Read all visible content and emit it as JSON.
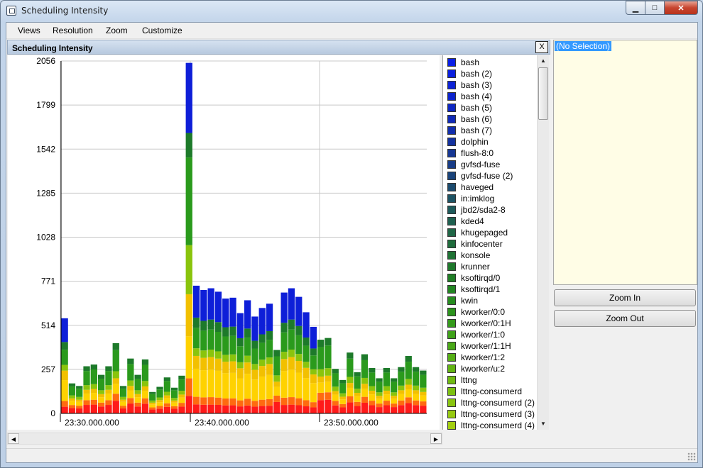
{
  "window": {
    "title": "Scheduling Intensity",
    "minimize_glyph": "▁",
    "maximize_glyph": "□",
    "close_glyph": "✕"
  },
  "menu": [
    "Views",
    "Resolution",
    "Zoom",
    "Customize"
  ],
  "pane": {
    "title": "Scheduling Intensity",
    "close_label": "X"
  },
  "details": {
    "selection_text": "(No Selection)"
  },
  "buttons": {
    "zoom_in": "Zoom In",
    "zoom_out": "Zoom Out"
  },
  "legend": [
    {
      "label": "bash",
      "color": "#0a1fe6"
    },
    {
      "label": "bash (2)",
      "color": "#0b20df"
    },
    {
      "label": "bash (3)",
      "color": "#0c22d6"
    },
    {
      "label": "bash (4)",
      "color": "#0d24cc"
    },
    {
      "label": "bash (5)",
      "color": "#0e27c2"
    },
    {
      "label": "bash (6)",
      "color": "#102ab8"
    },
    {
      "label": "bash (7)",
      "color": "#122eac"
    },
    {
      "label": "dolphin",
      "color": "#14329f"
    },
    {
      "label": "flush-8:0",
      "color": "#163793"
    },
    {
      "label": "gvfsd-fuse",
      "color": "#183c86"
    },
    {
      "label": "gvfsd-fuse (2)",
      "color": "#1a437a"
    },
    {
      "label": "haveged",
      "color": "#1c4b6e"
    },
    {
      "label": "in:imklog",
      "color": "#1d5363"
    },
    {
      "label": "jbd2/sda2-8",
      "color": "#1e5a5a"
    },
    {
      "label": "kded4",
      "color": "#1f6050"
    },
    {
      "label": "khugepaged",
      "color": "#1f6646"
    },
    {
      "label": "kinfocenter",
      "color": "#1f6c3c"
    },
    {
      "label": "konsole",
      "color": "#1f7234"
    },
    {
      "label": "krunner",
      "color": "#1f782c"
    },
    {
      "label": "ksoftirqd/0",
      "color": "#207e26"
    },
    {
      "label": "ksoftirqd/1",
      "color": "#228522"
    },
    {
      "label": "kwin",
      "color": "#268c1f"
    },
    {
      "label": "kworker/0:0",
      "color": "#2c931d"
    },
    {
      "label": "kworker/0:1H",
      "color": "#349a1b"
    },
    {
      "label": "kworker/1:0",
      "color": "#3ea119"
    },
    {
      "label": "kworker/1:1H",
      "color": "#49a817"
    },
    {
      "label": "kworker/1:2",
      "color": "#55ae15"
    },
    {
      "label": "kworker/u:2",
      "color": "#62b413"
    },
    {
      "label": "lttng",
      "color": "#6fba12"
    },
    {
      "label": "lttng-consumerd",
      "color": "#7cc011"
    },
    {
      "label": "lttng-consumerd (2)",
      "color": "#89c510"
    },
    {
      "label": "lttng-consumerd (3)",
      "color": "#96ca10"
    },
    {
      "label": "lttng-consumerd (4)",
      "color": "#a3cf10"
    }
  ],
  "chart_data": {
    "type": "bar",
    "stacked": true,
    "y_ticks": [
      "2056",
      "1799",
      "1542",
      "1285",
      "1028",
      "771",
      "514",
      "257",
      "0"
    ],
    "ylim": [
      0,
      2056
    ],
    "x_ticks": [
      "23:30.000.000",
      "23:40.000.000",
      "23:50.000.000"
    ],
    "grid": true,
    "totals": [
      555,
      175,
      160,
      275,
      285,
      225,
      275,
      410,
      160,
      320,
      225,
      315,
      125,
      155,
      210,
      150,
      220,
      2045,
      745,
      720,
      730,
      710,
      670,
      675,
      585,
      660,
      565,
      615,
      640,
      370,
      705,
      730,
      680,
      590,
      505,
      430,
      440,
      260,
      195,
      355,
      240,
      345,
      265,
      205,
      265,
      205,
      270,
      335,
      270,
      250
    ]
  }
}
